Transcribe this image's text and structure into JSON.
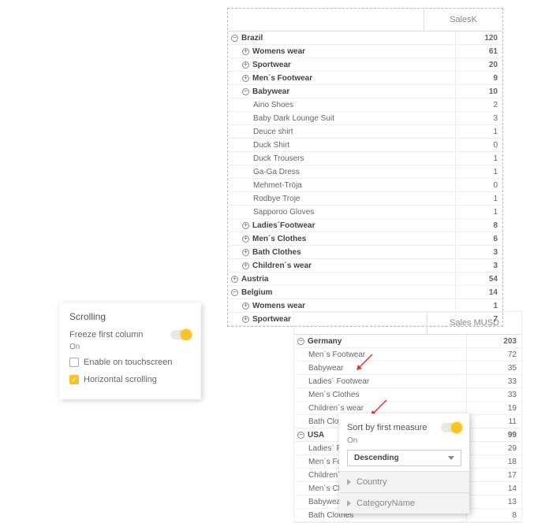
{
  "table1": {
    "header": "SalesK",
    "rows": [
      {
        "indent": 0,
        "icon": "minus",
        "bold": true,
        "label": "Brazil",
        "value": "120"
      },
      {
        "indent": 1,
        "icon": "plus",
        "bold": true,
        "label": "Womens wear",
        "value": "61"
      },
      {
        "indent": 1,
        "icon": "plus",
        "bold": true,
        "label": "Sportwear",
        "value": "20"
      },
      {
        "indent": 1,
        "icon": "plus",
        "bold": true,
        "label": "Men´s Footwear",
        "value": "9"
      },
      {
        "indent": 1,
        "icon": "minus",
        "bold": true,
        "label": "Babywear",
        "value": "10"
      },
      {
        "indent": 2,
        "icon": "",
        "bold": false,
        "label": "Aino Shoes",
        "value": "2"
      },
      {
        "indent": 2,
        "icon": "",
        "bold": false,
        "label": "Baby Dark Lounge Suit",
        "value": "3"
      },
      {
        "indent": 2,
        "icon": "",
        "bold": false,
        "label": "Deuce shirt",
        "value": "1"
      },
      {
        "indent": 2,
        "icon": "",
        "bold": false,
        "label": "Duck Shirt",
        "value": "0"
      },
      {
        "indent": 2,
        "icon": "",
        "bold": false,
        "label": "Duck Trousers",
        "value": "1"
      },
      {
        "indent": 2,
        "icon": "",
        "bold": false,
        "label": "Ga-Ga Dress",
        "value": "1"
      },
      {
        "indent": 2,
        "icon": "",
        "bold": false,
        "label": "Mehmet-Tröja",
        "value": "0"
      },
      {
        "indent": 2,
        "icon": "",
        "bold": false,
        "label": "Rodbye Troje",
        "value": "1"
      },
      {
        "indent": 2,
        "icon": "",
        "bold": false,
        "label": "Sapporoo Gloves",
        "value": "1"
      },
      {
        "indent": 1,
        "icon": "plus",
        "bold": true,
        "label": "Ladies´Footwear",
        "value": "8"
      },
      {
        "indent": 1,
        "icon": "plus",
        "bold": true,
        "label": "Men´s Clothes",
        "value": "6"
      },
      {
        "indent": 1,
        "icon": "plus",
        "bold": true,
        "label": "Bath Clothes",
        "value": "3"
      },
      {
        "indent": 1,
        "icon": "plus",
        "bold": true,
        "label": "Children´s wear",
        "value": "3"
      },
      {
        "indent": 0,
        "icon": "plus",
        "bold": true,
        "label": "Austria",
        "value": "54"
      },
      {
        "indent": 0,
        "icon": "minus",
        "bold": true,
        "label": "Belgium",
        "value": "14"
      },
      {
        "indent": 1,
        "icon": "plus",
        "bold": true,
        "label": "Womens wear",
        "value": "1"
      },
      {
        "indent": 1,
        "icon": "plus",
        "bold": true,
        "label": "Sportwear",
        "value": "7"
      }
    ]
  },
  "scrolling_panel": {
    "title": "Scrolling",
    "freeze_label": "Freeze first column",
    "on_text": "On",
    "enable_touch_label": "Enable on touchscreen",
    "horizontal_label": "Horizontal scrolling"
  },
  "table2": {
    "header": "Sales MUSD",
    "rows": [
      {
        "indent": 0,
        "icon": "minus",
        "bold": true,
        "label": "Germany",
        "value": "203"
      },
      {
        "indent": 1,
        "icon": "",
        "bold": false,
        "label": "Men´s Footwear",
        "value": "72"
      },
      {
        "indent": 1,
        "icon": "",
        "bold": false,
        "label": "Babywear",
        "value": "35"
      },
      {
        "indent": 1,
        "icon": "",
        "bold": false,
        "label": "Ladies´ Footwear",
        "value": "33"
      },
      {
        "indent": 1,
        "icon": "",
        "bold": false,
        "label": "Men´s Clothes",
        "value": "33"
      },
      {
        "indent": 1,
        "icon": "",
        "bold": false,
        "label": "Children´s wear",
        "value": "19"
      },
      {
        "indent": 1,
        "icon": "",
        "bold": false,
        "label": "Bath Clothes",
        "value": "11"
      },
      {
        "indent": 0,
        "icon": "minus",
        "bold": true,
        "label": "USA",
        "value": "99"
      },
      {
        "indent": 1,
        "icon": "",
        "bold": false,
        "label": "Ladies´ Footwear",
        "value": "29"
      },
      {
        "indent": 1,
        "icon": "",
        "bold": false,
        "label": "Men´s Footwear",
        "value": "18"
      },
      {
        "indent": 1,
        "icon": "",
        "bold": false,
        "label": "Children´s wear",
        "value": "17"
      },
      {
        "indent": 1,
        "icon": "",
        "bold": false,
        "label": "Men´s Clothes",
        "value": "14"
      },
      {
        "indent": 1,
        "icon": "",
        "bold": false,
        "label": "Babywear",
        "value": "13"
      },
      {
        "indent": 1,
        "icon": "",
        "bold": false,
        "label": "Bath Clothes",
        "value": "8"
      }
    ]
  },
  "sort_popup": {
    "title": "Sort by first measure",
    "on_text": "On",
    "select_value": "Descending",
    "items": [
      "Country",
      "CategoryName"
    ]
  }
}
